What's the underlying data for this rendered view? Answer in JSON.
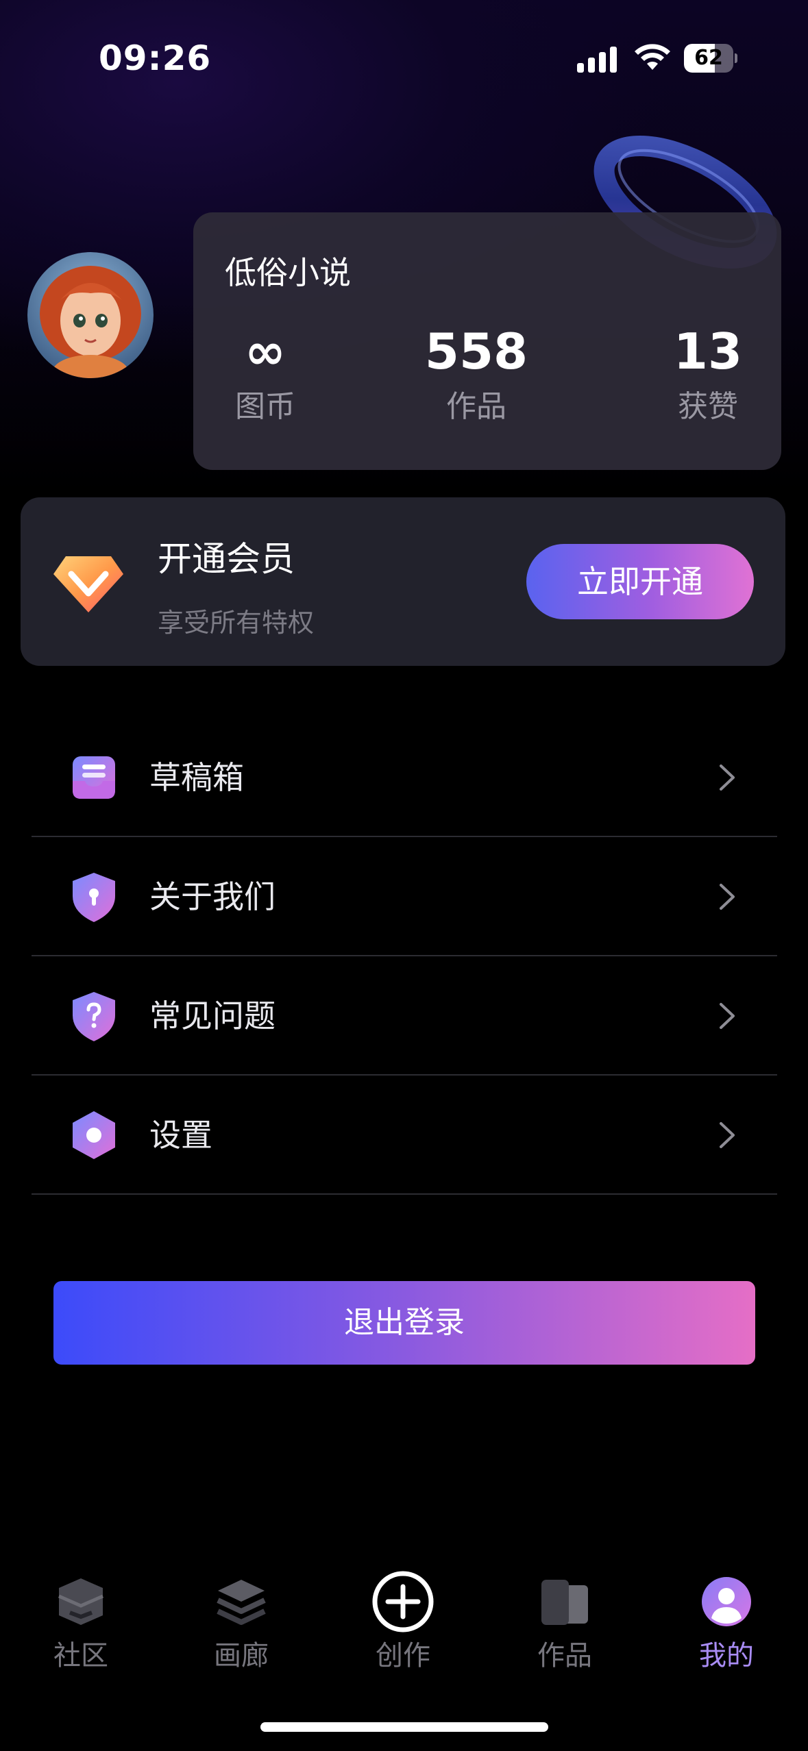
{
  "status_bar": {
    "time": "09:26",
    "battery": "62",
    "battery_level": 0.62
  },
  "profile": {
    "username": "低俗小说",
    "stats": [
      {
        "value": "∞",
        "label": "图币"
      },
      {
        "value": "558",
        "label": "作品"
      },
      {
        "value": "13",
        "label": "获赞"
      }
    ]
  },
  "vip": {
    "title": "开通会员",
    "subtitle": "享受所有特权",
    "button": "立即开通"
  },
  "menu": {
    "items": [
      {
        "label": "草稿箱",
        "icon": "inbox-icon"
      },
      {
        "label": "关于我们",
        "icon": "shield-lock-icon"
      },
      {
        "label": "常见问题",
        "icon": "shield-question-icon"
      },
      {
        "label": "设置",
        "icon": "hexagon-settings-icon"
      }
    ]
  },
  "logout": {
    "label": "退出登录"
  },
  "tab_bar": {
    "tabs": [
      {
        "label": "社区",
        "icon": "community-icon"
      },
      {
        "label": "画廊",
        "icon": "gallery-layers-icon"
      },
      {
        "label": "创作",
        "icon": "create-plus-icon"
      },
      {
        "label": "作品",
        "icon": "works-icon"
      },
      {
        "label": "我的",
        "icon": "profile-icon",
        "active": true
      }
    ]
  },
  "colors": {
    "accent": "#a98cf5",
    "gradient_start": "#3c4bfa",
    "gradient_end": "#e56ec6",
    "card_bg": "#2e2b38"
  }
}
